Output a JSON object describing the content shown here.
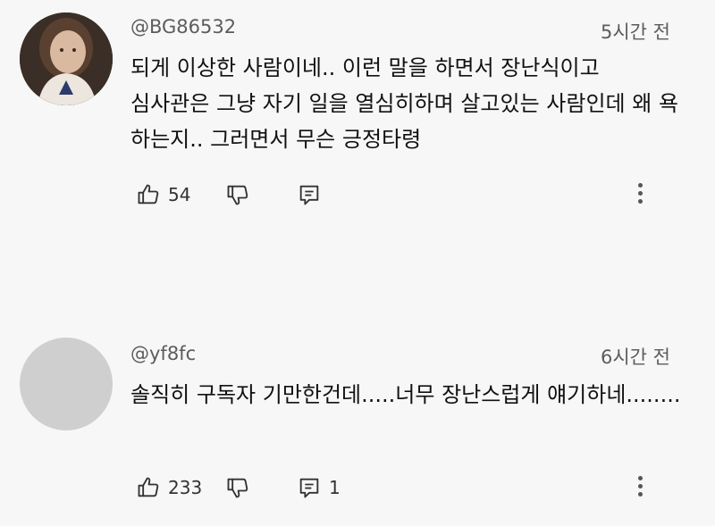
{
  "comments": [
    {
      "author": "@BG86532",
      "time": "5시간 전",
      "text": "되게 이상한 사람이네.. 이런 말을 하면서 장난식이고 심사관은 그냥 자기 일을 열심히하며 살고있는 사람인데 왜 욕 하는지.. 그러면서 무슨 긍정타령",
      "likes": "54",
      "replies": ""
    },
    {
      "author": "@yf8fc",
      "time": "6시간 전",
      "text": "솔직히 구독자 기만한건데.....너무 장난스럽게 얘기하네........",
      "likes": "233",
      "replies": "1"
    }
  ]
}
